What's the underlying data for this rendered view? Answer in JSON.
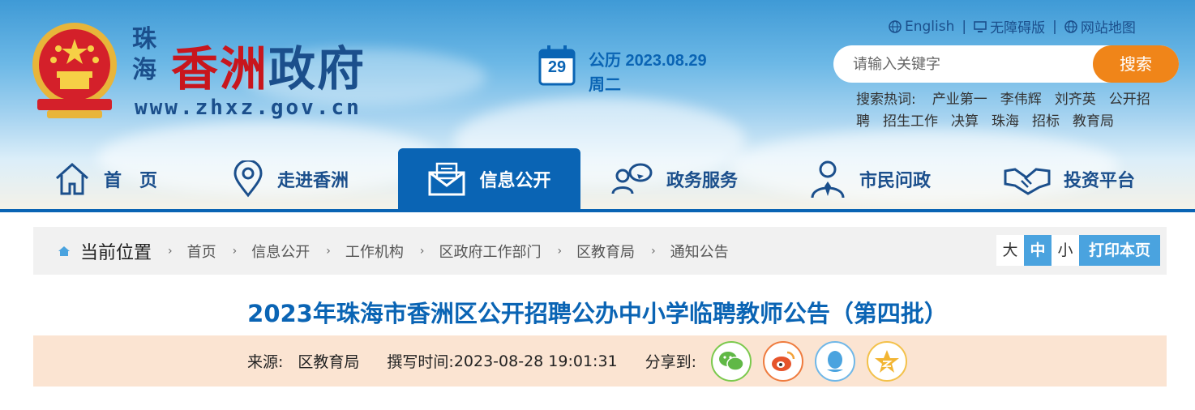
{
  "header": {
    "site_name_small": "珠海",
    "site_name_red": "香洲",
    "site_name_rest": "政府",
    "site_url": "www.zhxz.gov.cn",
    "date": {
      "calendar_day": "29",
      "line1": "公历 2023.08.29",
      "line2": "周二"
    },
    "top_links": [
      {
        "label": "English",
        "icon": "globe-icon"
      },
      {
        "label": "无障碍版",
        "icon": "monitor-icon"
      },
      {
        "label": "网站地图",
        "icon": "globe-icon"
      }
    ],
    "search": {
      "placeholder": "请输入关键字",
      "button": "搜索"
    },
    "hot_label": "搜索热词:",
    "hot_words": [
      "产业第一",
      "李伟辉",
      "刘齐英",
      "公开招聘",
      "招生工作",
      "决算",
      "珠海",
      "招标",
      "教育局"
    ]
  },
  "nav": [
    {
      "label": "首　页",
      "icon": "home-icon"
    },
    {
      "label": "走进香洲",
      "icon": "location-pin-icon"
    },
    {
      "label": "信息公开",
      "icon": "envelope-icon",
      "active": true
    },
    {
      "label": "政务服务",
      "icon": "people-chat-icon"
    },
    {
      "label": "市民问政",
      "icon": "person-tie-icon"
    },
    {
      "label": "投资平台",
      "icon": "handshake-icon"
    }
  ],
  "breadcrumb": {
    "current_label": "当前位置",
    "items": [
      "首页",
      "信息公开",
      "工作机构",
      "区政府工作部门",
      "区教育局",
      "通知公告"
    ]
  },
  "font_size": {
    "large": "大",
    "medium": "中",
    "small": "小",
    "selected": "中",
    "print": "打印本页"
  },
  "article": {
    "title": "2023年珠海市香洲区公开招聘公办中小学临聘教师公告（第四批）",
    "source_label": "来源:",
    "source": "区教育局",
    "time_label": "撰写时间:",
    "time": "2023-08-28 19:01:31",
    "share_label": "分享到:",
    "share_targets": [
      "wechat-icon",
      "weibo-icon",
      "qq-icon",
      "qzone-icon"
    ]
  },
  "colors": {
    "primary": "#0a64b4",
    "accent_orange": "#f08519",
    "emblem_red": "#c8161d",
    "meta_bg": "#fbe4d2",
    "size_active": "#4aa3df"
  }
}
